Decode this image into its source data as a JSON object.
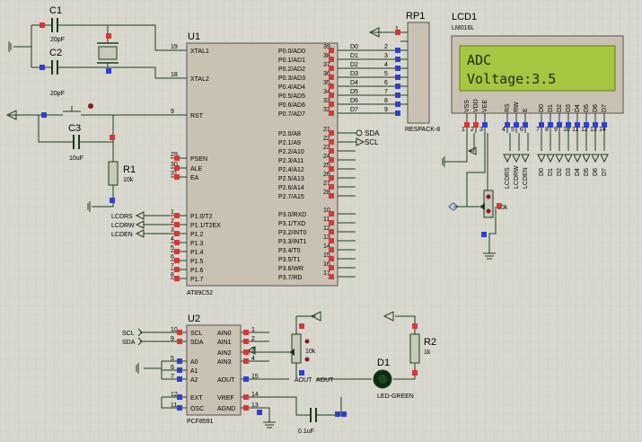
{
  "components": {
    "c1": {
      "ref": "C1",
      "value": "20pF"
    },
    "c2": {
      "ref": "C2",
      "value": "20pF"
    },
    "c3": {
      "ref": "C3",
      "value": "10uF"
    },
    "r1": {
      "ref": "R1",
      "value": "10k"
    },
    "r2": {
      "ref": "R2",
      "value": "1k"
    },
    "d1": {
      "ref": "D1",
      "value": "LED-GREEN"
    },
    "c_vref": {
      "value": "0.1uF"
    },
    "pot_lcd": {
      "value": "10k"
    },
    "pot_adc": {
      "value": "10k"
    },
    "rp1": {
      "ref": "RP1",
      "value": "RESPACK-8"
    },
    "lcd1": {
      "ref": "LCD1",
      "value": "LM016L",
      "line1": "ADC",
      "line2": "Voltage:3.5",
      "pins": [
        "VSS",
        "VDD",
        "VEE",
        "RS",
        "RW",
        "E",
        "D0",
        "D1",
        "D2",
        "D3",
        "D4",
        "D5",
        "D6",
        "D7"
      ],
      "pin_numbers": [
        "1",
        "2",
        "3",
        "4",
        "5",
        "6",
        "7",
        "8",
        "9",
        "10",
        "11",
        "12",
        "13",
        "14"
      ]
    },
    "u1": {
      "ref": "U1",
      "value": "AT89C52",
      "left_pins": [
        {
          "num": "19",
          "name": "XTAL1"
        },
        {
          "num": "18",
          "name": "XTAL2"
        },
        {
          "num": "9",
          "name": "RST"
        },
        {
          "num": "29",
          "name": "PSEN"
        },
        {
          "num": "30",
          "name": "ALE"
        },
        {
          "num": "31",
          "name": "EA"
        },
        {
          "num": "1",
          "name": "P1.0/T2"
        },
        {
          "num": "2",
          "name": "P1.1/T2EX"
        },
        {
          "num": "3",
          "name": "P1.2"
        },
        {
          "num": "4",
          "name": "P1.3"
        },
        {
          "num": "5",
          "name": "P1.4"
        },
        {
          "num": "6",
          "name": "P1.5"
        },
        {
          "num": "7",
          "name": "P1.6"
        },
        {
          "num": "8",
          "name": "P1.7"
        }
      ],
      "right_pins": [
        {
          "num": "39",
          "name": "P0.0/AD0"
        },
        {
          "num": "38",
          "name": "P0.1/AD1"
        },
        {
          "num": "37",
          "name": "P0.2/AD2"
        },
        {
          "num": "36",
          "name": "P0.3/AD3"
        },
        {
          "num": "35",
          "name": "P0.4/AD4"
        },
        {
          "num": "34",
          "name": "P0.5/AD5"
        },
        {
          "num": "33",
          "name": "P0.6/AD6"
        },
        {
          "num": "32",
          "name": "P0.7/AD7"
        },
        {
          "num": "21",
          "name": "P2.0/A8"
        },
        {
          "num": "22",
          "name": "P2.1/A9"
        },
        {
          "num": "23",
          "name": "P2.2/A10"
        },
        {
          "num": "24",
          "name": "P2.3/A11"
        },
        {
          "num": "25",
          "name": "P2.4/A12"
        },
        {
          "num": "26",
          "name": "P2.5/A13"
        },
        {
          "num": "27",
          "name": "P2.6/A14"
        },
        {
          "num": "28",
          "name": "P2.7/A15"
        },
        {
          "num": "10",
          "name": "P3.0/RXD"
        },
        {
          "num": "11",
          "name": "P3.1/TXD"
        },
        {
          "num": "12",
          "name": "P3.2/INT0"
        },
        {
          "num": "13",
          "name": "P3.3/INT1"
        },
        {
          "num": "14",
          "name": "P3.4/T0"
        },
        {
          "num": "15",
          "name": "P3.5/T1"
        },
        {
          "num": "16",
          "name": "P3.6/WR"
        },
        {
          "num": "17",
          "name": "P3.7/RD"
        }
      ]
    },
    "u2": {
      "ref": "U2",
      "value": "PCF8591",
      "left_pins": [
        {
          "num": "10",
          "name": "SCL"
        },
        {
          "num": "9",
          "name": "SDA"
        },
        {
          "num": "5",
          "name": "A0"
        },
        {
          "num": "6",
          "name": "A1"
        },
        {
          "num": "7",
          "name": "A2"
        },
        {
          "num": "12",
          "name": "EXT"
        },
        {
          "num": "11",
          "name": "OSC"
        }
      ],
      "right_pins": [
        {
          "num": "1",
          "name": "AIN0"
        },
        {
          "num": "2",
          "name": "AIN1"
        },
        {
          "num": "3",
          "name": "AIN2"
        },
        {
          "num": "4",
          "name": "AIN3"
        },
        {
          "num": "15",
          "name": "AOUT"
        },
        {
          "num": "14",
          "name": "VREF"
        },
        {
          "num": "13",
          "name": "AGND"
        }
      ]
    }
  },
  "nets": {
    "data_bus": [
      "D0",
      "D1",
      "D2",
      "D3",
      "D4",
      "D5",
      "D6",
      "D7"
    ],
    "rp1_pins": [
      "2",
      "3",
      "4",
      "5",
      "6",
      "7",
      "8",
      "9"
    ],
    "rp1_common": "1",
    "sda": "SDA",
    "scl": "SCL",
    "lcd_ctrl": [
      "LCDRS",
      "LCDRW",
      "LCDEN"
    ],
    "u2_scl": "SCL",
    "u2_sda": "SDA",
    "aout": "AOUT",
    "aout2": "AOUT"
  }
}
